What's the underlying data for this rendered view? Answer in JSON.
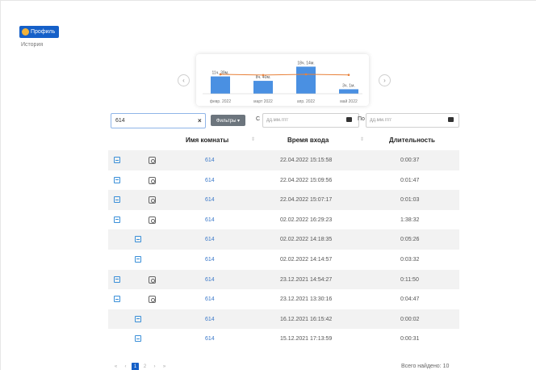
{
  "header": {
    "profile_label": "Профиль",
    "history_label": "История"
  },
  "nav": {
    "prev_icon": "chevron-left-icon",
    "next_icon": "chevron-right-icon",
    "prev_glyph": "‹",
    "next_glyph": "›"
  },
  "chart_data": {
    "type": "bar",
    "categories": [
      "февр. 2022",
      "март 2022",
      "апр. 2022",
      "май 2022"
    ],
    "bar_labels": [
      "11ч. 39м.",
      "8ч. 40м.",
      "18ч. 14м.",
      "3ч. 1м."
    ],
    "values_hours": [
      11.65,
      8.67,
      18.23,
      3.02
    ],
    "line_values": [
      9.8,
      9.3,
      9.8,
      9.4
    ],
    "colors": {
      "bar": "#4a90e2",
      "line": "#e8813a"
    }
  },
  "filters": {
    "search_value": "614",
    "clear_glyph": "×",
    "filter_button": "Фильтры ▾",
    "from_label": "С",
    "to_label": "По",
    "date_placeholder": "дд.мм.гггг"
  },
  "table": {
    "headers": {
      "room": "Имя комнаты",
      "entry_time": "Время входа",
      "duration": "Длительность"
    },
    "sort_glyph": "⇕",
    "rows": [
      {
        "room": "614",
        "time": "22.04.2022 15:15:58",
        "duration": "0:00:37",
        "recording": true
      },
      {
        "room": "614",
        "time": "22.04.2022 15:09:56",
        "duration": "0:01:47",
        "recording": true
      },
      {
        "room": "614",
        "time": "22.04.2022 15:07:17",
        "duration": "0:01:03",
        "recording": true
      },
      {
        "room": "614",
        "time": "02.02.2022 16:29:23",
        "duration": "1:38:32",
        "recording": true
      },
      {
        "room": "614",
        "time": "02.02.2022 14:18:35",
        "duration": "0:05:26",
        "recording": false
      },
      {
        "room": "614",
        "time": "02.02.2022 14:14:57",
        "duration": "0:03:32",
        "recording": false
      },
      {
        "room": "614",
        "time": "23.12.2021 14:54:27",
        "duration": "0:11:50",
        "recording": true
      },
      {
        "room": "614",
        "time": "23.12.2021 13:30:16",
        "duration": "0:04:47",
        "recording": true
      },
      {
        "room": "614",
        "time": "16.12.2021 16:15:42",
        "duration": "0:00:02",
        "recording": false
      },
      {
        "room": "614",
        "time": "15.12.2021 17:13:59",
        "duration": "0:00:31",
        "recording": false
      }
    ]
  },
  "pagination": {
    "first": "«",
    "prev": "‹",
    "pages": [
      "1",
      "2"
    ],
    "next": "›",
    "last": "»",
    "active": "1"
  },
  "footer": {
    "total": "Всего найдено: 10"
  }
}
